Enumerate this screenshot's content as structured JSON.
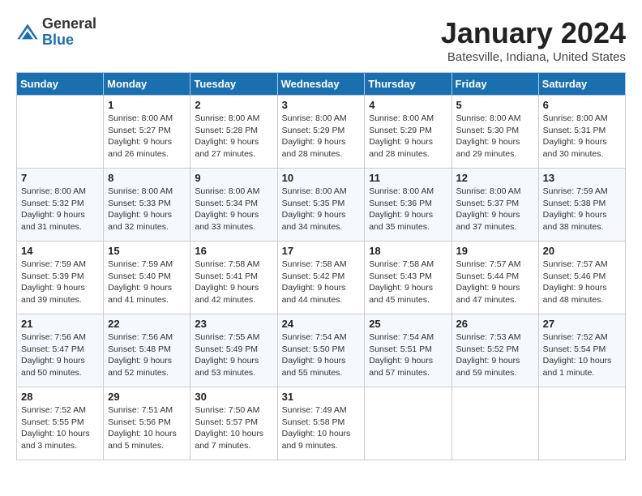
{
  "logo": {
    "general": "General",
    "blue": "Blue"
  },
  "title": "January 2024",
  "subtitle": "Batesville, Indiana, United States",
  "days_of_week": [
    "Sunday",
    "Monday",
    "Tuesday",
    "Wednesday",
    "Thursday",
    "Friday",
    "Saturday"
  ],
  "weeks": [
    [
      {
        "day": "",
        "sunrise": "",
        "sunset": "",
        "daylight": ""
      },
      {
        "day": "1",
        "sunrise": "Sunrise: 8:00 AM",
        "sunset": "Sunset: 5:27 PM",
        "daylight": "Daylight: 9 hours and 26 minutes."
      },
      {
        "day": "2",
        "sunrise": "Sunrise: 8:00 AM",
        "sunset": "Sunset: 5:28 PM",
        "daylight": "Daylight: 9 hours and 27 minutes."
      },
      {
        "day": "3",
        "sunrise": "Sunrise: 8:00 AM",
        "sunset": "Sunset: 5:29 PM",
        "daylight": "Daylight: 9 hours and 28 minutes."
      },
      {
        "day": "4",
        "sunrise": "Sunrise: 8:00 AM",
        "sunset": "Sunset: 5:29 PM",
        "daylight": "Daylight: 9 hours and 28 minutes."
      },
      {
        "day": "5",
        "sunrise": "Sunrise: 8:00 AM",
        "sunset": "Sunset: 5:30 PM",
        "daylight": "Daylight: 9 hours and 29 minutes."
      },
      {
        "day": "6",
        "sunrise": "Sunrise: 8:00 AM",
        "sunset": "Sunset: 5:31 PM",
        "daylight": "Daylight: 9 hours and 30 minutes."
      }
    ],
    [
      {
        "day": "7",
        "sunrise": "Sunrise: 8:00 AM",
        "sunset": "Sunset: 5:32 PM",
        "daylight": "Daylight: 9 hours and 31 minutes."
      },
      {
        "day": "8",
        "sunrise": "Sunrise: 8:00 AM",
        "sunset": "Sunset: 5:33 PM",
        "daylight": "Daylight: 9 hours and 32 minutes."
      },
      {
        "day": "9",
        "sunrise": "Sunrise: 8:00 AM",
        "sunset": "Sunset: 5:34 PM",
        "daylight": "Daylight: 9 hours and 33 minutes."
      },
      {
        "day": "10",
        "sunrise": "Sunrise: 8:00 AM",
        "sunset": "Sunset: 5:35 PM",
        "daylight": "Daylight: 9 hours and 34 minutes."
      },
      {
        "day": "11",
        "sunrise": "Sunrise: 8:00 AM",
        "sunset": "Sunset: 5:36 PM",
        "daylight": "Daylight: 9 hours and 35 minutes."
      },
      {
        "day": "12",
        "sunrise": "Sunrise: 8:00 AM",
        "sunset": "Sunset: 5:37 PM",
        "daylight": "Daylight: 9 hours and 37 minutes."
      },
      {
        "day": "13",
        "sunrise": "Sunrise: 7:59 AM",
        "sunset": "Sunset: 5:38 PM",
        "daylight": "Daylight: 9 hours and 38 minutes."
      }
    ],
    [
      {
        "day": "14",
        "sunrise": "Sunrise: 7:59 AM",
        "sunset": "Sunset: 5:39 PM",
        "daylight": "Daylight: 9 hours and 39 minutes."
      },
      {
        "day": "15",
        "sunrise": "Sunrise: 7:59 AM",
        "sunset": "Sunset: 5:40 PM",
        "daylight": "Daylight: 9 hours and 41 minutes."
      },
      {
        "day": "16",
        "sunrise": "Sunrise: 7:58 AM",
        "sunset": "Sunset: 5:41 PM",
        "daylight": "Daylight: 9 hours and 42 minutes."
      },
      {
        "day": "17",
        "sunrise": "Sunrise: 7:58 AM",
        "sunset": "Sunset: 5:42 PM",
        "daylight": "Daylight: 9 hours and 44 minutes."
      },
      {
        "day": "18",
        "sunrise": "Sunrise: 7:58 AM",
        "sunset": "Sunset: 5:43 PM",
        "daylight": "Daylight: 9 hours and 45 minutes."
      },
      {
        "day": "19",
        "sunrise": "Sunrise: 7:57 AM",
        "sunset": "Sunset: 5:44 PM",
        "daylight": "Daylight: 9 hours and 47 minutes."
      },
      {
        "day": "20",
        "sunrise": "Sunrise: 7:57 AM",
        "sunset": "Sunset: 5:46 PM",
        "daylight": "Daylight: 9 hours and 48 minutes."
      }
    ],
    [
      {
        "day": "21",
        "sunrise": "Sunrise: 7:56 AM",
        "sunset": "Sunset: 5:47 PM",
        "daylight": "Daylight: 9 hours and 50 minutes."
      },
      {
        "day": "22",
        "sunrise": "Sunrise: 7:56 AM",
        "sunset": "Sunset: 5:48 PM",
        "daylight": "Daylight: 9 hours and 52 minutes."
      },
      {
        "day": "23",
        "sunrise": "Sunrise: 7:55 AM",
        "sunset": "Sunset: 5:49 PM",
        "daylight": "Daylight: 9 hours and 53 minutes."
      },
      {
        "day": "24",
        "sunrise": "Sunrise: 7:54 AM",
        "sunset": "Sunset: 5:50 PM",
        "daylight": "Daylight: 9 hours and 55 minutes."
      },
      {
        "day": "25",
        "sunrise": "Sunrise: 7:54 AM",
        "sunset": "Sunset: 5:51 PM",
        "daylight": "Daylight: 9 hours and 57 minutes."
      },
      {
        "day": "26",
        "sunrise": "Sunrise: 7:53 AM",
        "sunset": "Sunset: 5:52 PM",
        "daylight": "Daylight: 9 hours and 59 minutes."
      },
      {
        "day": "27",
        "sunrise": "Sunrise: 7:52 AM",
        "sunset": "Sunset: 5:54 PM",
        "daylight": "Daylight: 10 hours and 1 minute."
      }
    ],
    [
      {
        "day": "28",
        "sunrise": "Sunrise: 7:52 AM",
        "sunset": "Sunset: 5:55 PM",
        "daylight": "Daylight: 10 hours and 3 minutes."
      },
      {
        "day": "29",
        "sunrise": "Sunrise: 7:51 AM",
        "sunset": "Sunset: 5:56 PM",
        "daylight": "Daylight: 10 hours and 5 minutes."
      },
      {
        "day": "30",
        "sunrise": "Sunrise: 7:50 AM",
        "sunset": "Sunset: 5:57 PM",
        "daylight": "Daylight: 10 hours and 7 minutes."
      },
      {
        "day": "31",
        "sunrise": "Sunrise: 7:49 AM",
        "sunset": "Sunset: 5:58 PM",
        "daylight": "Daylight: 10 hours and 9 minutes."
      },
      {
        "day": "",
        "sunrise": "",
        "sunset": "",
        "daylight": ""
      },
      {
        "day": "",
        "sunrise": "",
        "sunset": "",
        "daylight": ""
      },
      {
        "day": "",
        "sunrise": "",
        "sunset": "",
        "daylight": ""
      }
    ]
  ]
}
